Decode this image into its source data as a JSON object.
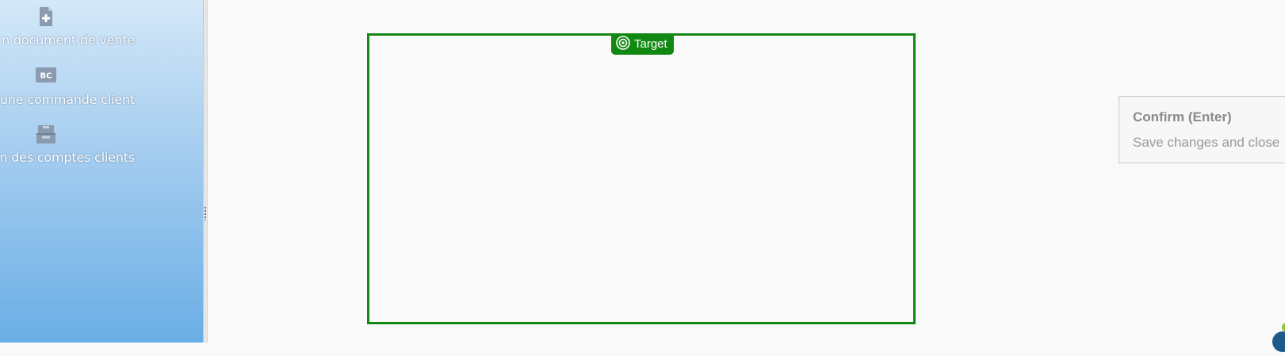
{
  "sidebar": {
    "items": [
      {
        "label": "n document de vente",
        "icon": "new-document-icon"
      },
      {
        "label": "une commande client",
        "icon": "bc-order-icon",
        "icon_text": "BC"
      },
      {
        "label": "n des comptes clients",
        "icon": "archive-box-icon"
      }
    ]
  },
  "target": {
    "label": "Target",
    "icon": "target-icon",
    "color": "#118811"
  },
  "tooltip": {
    "title": "Confirm (Enter)",
    "description": "Save changes and close"
  }
}
